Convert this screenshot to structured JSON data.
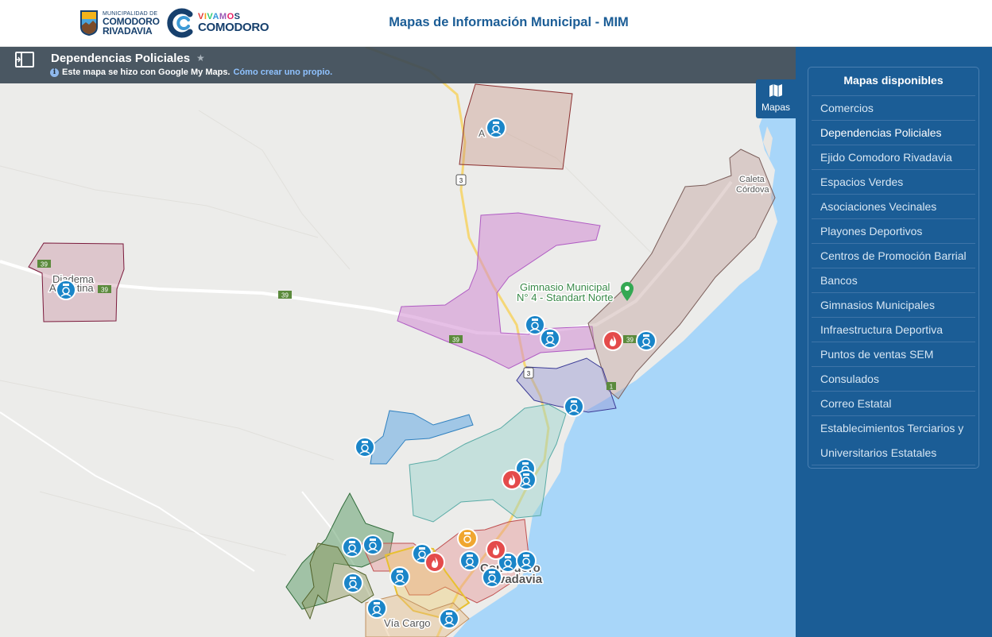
{
  "header": {
    "logo_muni_small": "MUNICIPALIDAD DE",
    "logo_muni_line1": "COMODORO",
    "logo_muni_line2": "RIVADAVIA",
    "logo_viv_line1": "VIVAMOS",
    "logo_viv_line2": "COMODORO",
    "title": "Mapas de Información Municipal - MIM"
  },
  "mymaps": {
    "title": "Dependencias Policiales",
    "star": "★",
    "subtitle": "Este mapa se hizo con Google My Maps.",
    "link": "Cómo crear uno propio.",
    "info": "i"
  },
  "mapas_button": {
    "label": "Mapas"
  },
  "side": {
    "title": "Mapas disponibles",
    "items": [
      {
        "label": "Comercios"
      },
      {
        "label": "Dependencias Policiales"
      },
      {
        "label": "Ejido Comodoro Rivadavia"
      },
      {
        "label": "Espacios Verdes"
      },
      {
        "label": "Asociaciones Vecinales"
      },
      {
        "label": "Playones Deportivos"
      },
      {
        "label": "Centros de Promoción Barrial"
      },
      {
        "label": "Bancos"
      },
      {
        "label": "Gimnasios Municipales"
      },
      {
        "label": "Infraestructura Deportiva"
      },
      {
        "label": "Puntos de ventas SEM"
      },
      {
        "label": "Consulados"
      },
      {
        "label": "Correo Estatal"
      },
      {
        "label": "Establecimientos Terciarios y Universitarios Estatales"
      }
    ]
  },
  "map": {
    "colors": {
      "water": "#a8d6f9",
      "land": "#ececea",
      "road": "#ffffff",
      "highway": "#f5d777",
      "police": "#1a85c8",
      "fire": "#e44b4b",
      "other": "#f0a630"
    },
    "labels": {
      "diadema": "Diadema",
      "argentina": "Argentina",
      "caleta": "Caleta",
      "cordova": "Córdova",
      "gimnasio1": "Gimnasio Municipal",
      "gimnasio2": "N° 4 - Standart Norte",
      "comodoro": "Comodoro",
      "rivadavia": "Rivadavia",
      "via_cargo": "Vía Cargo",
      "a_label": "A",
      "shield_39": "39",
      "shield_3": "3",
      "shield_1": "1"
    }
  }
}
